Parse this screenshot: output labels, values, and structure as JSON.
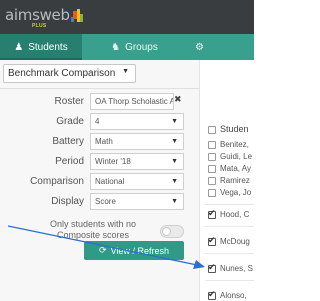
{
  "app": {
    "logo_text": "aimsweb",
    "logo_plus": "PLUS"
  },
  "tabs": [
    {
      "label": "Students",
      "icon": "person-icon"
    },
    {
      "label": "Groups",
      "icon": "group-icon"
    },
    {
      "label": "",
      "icon": "gears-icon"
    }
  ],
  "view_select": {
    "value": "Benchmark Comparison"
  },
  "filters": {
    "roster": {
      "label": "Roster",
      "value": "OA Thorp Scholastic Ac"
    },
    "grade": {
      "label": "Grade",
      "value": "4"
    },
    "battery": {
      "label": "Battery",
      "value": "Math"
    },
    "period": {
      "label": "Period",
      "value": "Winter '18"
    },
    "comparison": {
      "label": "Comparison",
      "value": "National"
    },
    "display": {
      "label": "Display",
      "value": "Score"
    }
  },
  "only_students": {
    "label": "Only students with no Composite scores",
    "enabled": false
  },
  "refresh_button": {
    "label": "View / Refresh"
  },
  "student_table": {
    "header": "Studen",
    "rows": [
      {
        "name": "Benitez,",
        "checked": false
      },
      {
        "name": "Guidi, Le",
        "checked": false
      },
      {
        "name": "Mata, Ay",
        "checked": false
      },
      {
        "name": "Ramirez",
        "checked": false
      },
      {
        "name": "Vega, Jo",
        "checked": false
      },
      {
        "name": "Hood, C",
        "checked": true
      },
      {
        "name": "McDoug",
        "checked": true
      },
      {
        "name": "Nunes, S",
        "checked": true
      },
      {
        "name": "Alonso,",
        "checked": true
      }
    ]
  },
  "colors": {
    "topbar": "#3a3d40",
    "tab_bar": "#3aa08e",
    "tab_active": "#27806f",
    "button": "#2f9a86",
    "arrow": "#2a6fd0"
  }
}
